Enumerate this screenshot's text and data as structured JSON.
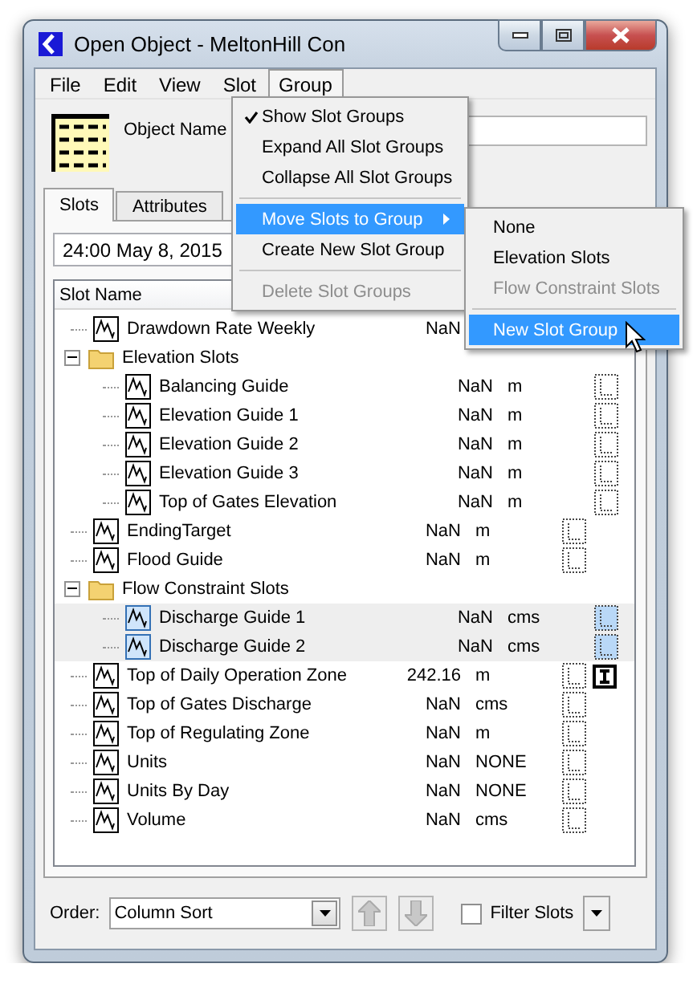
{
  "window": {
    "title": "Open Object - MeltonHill Con"
  },
  "menu_bar": [
    {
      "label": "File",
      "open": false
    },
    {
      "label": "Edit",
      "open": false
    },
    {
      "label": "View",
      "open": false
    },
    {
      "label": "Slot",
      "open": false
    },
    {
      "label": "Group",
      "open": true
    }
  ],
  "object_name": {
    "label": "Object Name"
  },
  "tabs": [
    {
      "label": "Slots",
      "selected": true
    },
    {
      "label": "Attributes",
      "selected": false
    }
  ],
  "date_field": {
    "value": "24:00 May 8, 2015"
  },
  "tree": {
    "column_header": "Slot Name",
    "rows": [
      {
        "kind": "slot",
        "name": "Drawdown Rate Weekly",
        "value": "NaN",
        "selected": false,
        "flagged": false
      },
      {
        "kind": "group",
        "name": "Elevation Slots",
        "expanded": true,
        "children": [
          {
            "kind": "slot",
            "name": "Balancing Guide",
            "value": "NaN",
            "unit": "m",
            "selected": false,
            "flagged": false
          },
          {
            "kind": "slot",
            "name": "Elevation Guide 1",
            "value": "NaN",
            "unit": "m",
            "selected": false,
            "flagged": false
          },
          {
            "kind": "slot",
            "name": "Elevation Guide 2",
            "value": "NaN",
            "unit": "m",
            "selected": false,
            "flagged": false
          },
          {
            "kind": "slot",
            "name": "Elevation Guide 3",
            "value": "NaN",
            "unit": "m",
            "selected": false,
            "flagged": false
          },
          {
            "kind": "slot",
            "name": "Top of Gates Elevation",
            "value": "NaN",
            "unit": "m",
            "selected": false,
            "flagged": false
          }
        ]
      },
      {
        "kind": "slot",
        "name": "EndingTarget",
        "value": "NaN",
        "unit": "m",
        "selected": false,
        "flagged": false
      },
      {
        "kind": "slot",
        "name": "Flood Guide",
        "value": "NaN",
        "unit": "m",
        "selected": false,
        "flagged": false
      },
      {
        "kind": "group",
        "name": "Flow Constraint Slots",
        "expanded": true,
        "children": [
          {
            "kind": "slot",
            "name": "Discharge Guide 1",
            "value": "NaN",
            "unit": "cms",
            "selected": true,
            "flagged": false
          },
          {
            "kind": "slot",
            "name": "Discharge Guide 2",
            "value": "NaN",
            "unit": "cms",
            "selected": true,
            "flagged": false
          }
        ]
      },
      {
        "kind": "slot",
        "name": "Top of Daily Operation Zone",
        "value": "242.16",
        "unit": "m",
        "selected": false,
        "flagged": true
      },
      {
        "kind": "slot",
        "name": "Top of Gates Discharge",
        "value": "NaN",
        "unit": "cms",
        "selected": false,
        "flagged": false
      },
      {
        "kind": "slot",
        "name": "Top of Regulating Zone",
        "value": "NaN",
        "unit": "m",
        "selected": false,
        "flagged": false
      },
      {
        "kind": "slot",
        "name": "Units",
        "value": "NaN",
        "unit": "NONE",
        "selected": false,
        "flagged": false
      },
      {
        "kind": "slot",
        "name": "Units By Day",
        "value": "NaN",
        "unit": "NONE",
        "selected": false,
        "flagged": false
      },
      {
        "kind": "slot",
        "name": "Volume",
        "value": "NaN",
        "unit": "cms",
        "selected": false,
        "flagged": false
      }
    ]
  },
  "bottom_bar": {
    "order_label": "Order:",
    "order_select": "Column Sort",
    "move_up_disabled": true,
    "move_down_disabled": true,
    "filter": {
      "label": "Filter Slots",
      "checked": false
    }
  },
  "group_menu": [
    {
      "kind": "item",
      "label": "Show Slot Groups",
      "checked": true,
      "disabled": false,
      "highlighted": false,
      "submenu": false
    },
    {
      "kind": "item",
      "label": "Expand All Slot Groups",
      "checked": false,
      "disabled": false,
      "highlighted": false,
      "submenu": false
    },
    {
      "kind": "item",
      "label": "Collapse All Slot Groups",
      "checked": false,
      "disabled": false,
      "highlighted": false,
      "submenu": false
    },
    {
      "kind": "separator"
    },
    {
      "kind": "item",
      "label": "Move Slots to Group",
      "checked": false,
      "disabled": false,
      "highlighted": true,
      "submenu": true
    },
    {
      "kind": "item",
      "label": "Create New Slot Group",
      "checked": false,
      "disabled": false,
      "highlighted": false,
      "submenu": false
    },
    {
      "kind": "separator"
    },
    {
      "kind": "item",
      "label": "Delete Slot Groups",
      "checked": false,
      "disabled": true,
      "highlighted": false,
      "submenu": false
    }
  ],
  "submenu": [
    {
      "kind": "item",
      "label": "None",
      "disabled": false,
      "highlighted": false
    },
    {
      "kind": "item",
      "label": "Elevation Slots",
      "disabled": false,
      "highlighted": false
    },
    {
      "kind": "item",
      "label": "Flow Constraint Slots",
      "disabled": true,
      "highlighted": false
    },
    {
      "kind": "separator"
    },
    {
      "kind": "item",
      "label": "New Slot Group",
      "disabled": false,
      "highlighted": true
    }
  ]
}
